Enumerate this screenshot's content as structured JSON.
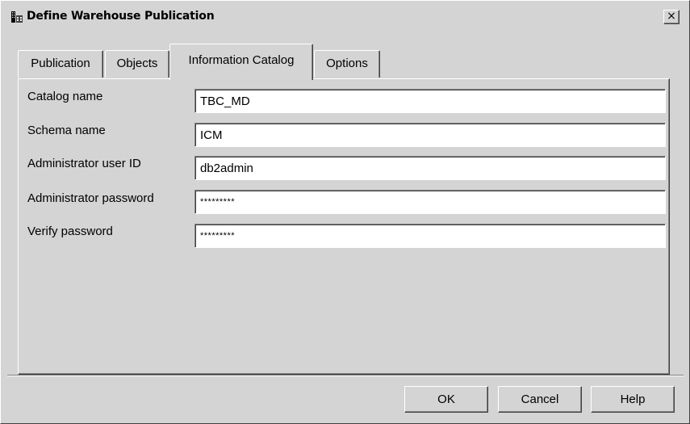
{
  "window": {
    "title": "Define Warehouse Publication",
    "close_glyph": "×"
  },
  "tabs": [
    {
      "label": "Publication",
      "active": false
    },
    {
      "label": "Objects",
      "active": false
    },
    {
      "label": "Information Catalog",
      "active": true
    },
    {
      "label": "Options",
      "active": false
    }
  ],
  "form": {
    "catalog_name": {
      "label": "Catalog name",
      "value": "TBC_MD"
    },
    "schema_name": {
      "label": "Schema name",
      "value": "ICM"
    },
    "admin_user": {
      "label": "Administrator user ID",
      "value": "db2admin"
    },
    "admin_password": {
      "label": "Administrator password",
      "value": "*********"
    },
    "verify_password": {
      "label": "Verify password",
      "value": "*********"
    }
  },
  "buttons": {
    "ok": "OK",
    "cancel": "Cancel",
    "help": "Help"
  },
  "icons": {
    "app": "warehouse-app-icon",
    "close": "close-icon"
  }
}
